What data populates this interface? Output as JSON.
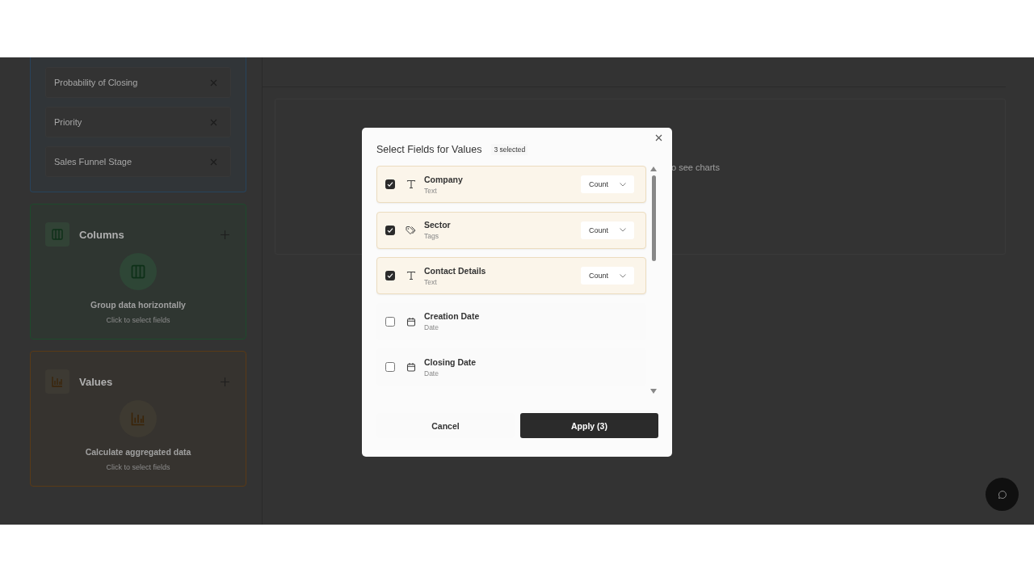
{
  "sidebar": {
    "sections": [
      {
        "kind": "list",
        "color": "#27435c",
        "items": [
          {
            "label": "Probability of Closing"
          },
          {
            "label": "Priority"
          },
          {
            "label": "Sales Funnel Stage"
          }
        ]
      },
      {
        "kind": "columns",
        "color": "#1d4a2c",
        "title": "Columns",
        "hint": "Group data horizontally",
        "subhint": "Click to select fields"
      },
      {
        "kind": "values",
        "color": "#5a3a16",
        "title": "Values",
        "hint": "Calculate aggregated data",
        "subhint": "Click to select fields"
      }
    ]
  },
  "main": {
    "hint": "o see charts"
  },
  "dialog": {
    "title": "Select Fields for Values",
    "badge": "3 selected",
    "fields": [
      {
        "name": "Company",
        "type": "Text",
        "kind": "text",
        "checked": true,
        "aggregate": "Count"
      },
      {
        "name": "Sector",
        "type": "Tags",
        "kind": "tags",
        "checked": true,
        "aggregate": "Count"
      },
      {
        "name": "Contact Details",
        "type": "Text",
        "kind": "text",
        "checked": true,
        "aggregate": "Count"
      },
      {
        "name": "Creation Date",
        "type": "Date",
        "kind": "date",
        "checked": false
      },
      {
        "name": "Closing Date",
        "type": "Date",
        "kind": "date",
        "checked": false
      }
    ],
    "cancel": "Cancel",
    "apply": "Apply (3)"
  }
}
